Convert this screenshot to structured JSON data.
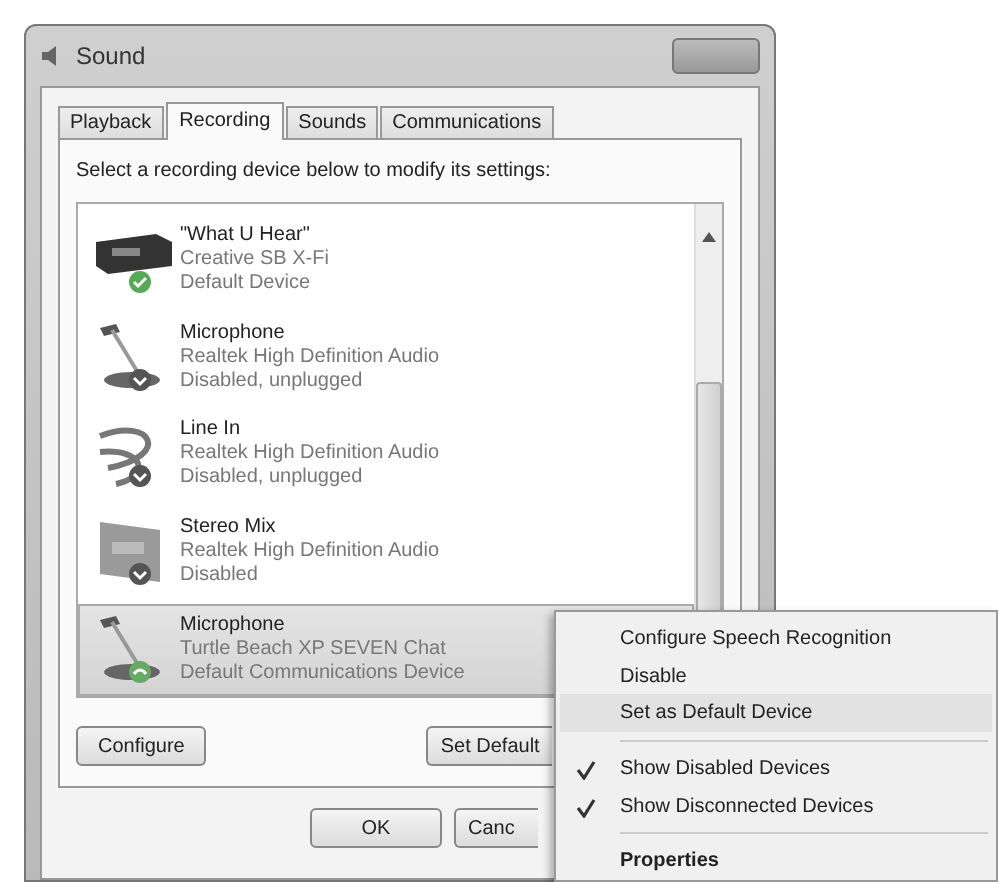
{
  "window": {
    "title": "Sound"
  },
  "tabs": [
    {
      "label": "Playback",
      "selected": false
    },
    {
      "label": "Recording",
      "selected": true
    },
    {
      "label": "Sounds",
      "selected": false
    },
    {
      "label": "Communications",
      "selected": false
    }
  ],
  "instruction": "Select a recording device below to modify its settings:",
  "devices": [
    {
      "kind": "sound-card",
      "name": "\"What U Hear\"",
      "driver": "Creative SB X-Fi",
      "status": "Default Device",
      "default_device": true,
      "default_communications": false,
      "disabled": false,
      "selected": false
    },
    {
      "kind": "microphone",
      "name": "Microphone",
      "driver": "Realtek High Definition Audio",
      "status": "Disabled, unplugged",
      "default_device": false,
      "default_communications": false,
      "disabled": true,
      "selected": false
    },
    {
      "kind": "line-in",
      "name": "Line In",
      "driver": "Realtek High Definition Audio",
      "status": "Disabled, unplugged",
      "default_device": false,
      "default_communications": false,
      "disabled": true,
      "selected": false
    },
    {
      "kind": "stereo-mix",
      "name": "Stereo Mix",
      "driver": "Realtek High Definition Audio",
      "status": "Disabled",
      "default_device": false,
      "default_communications": false,
      "disabled": true,
      "selected": false
    },
    {
      "kind": "microphone",
      "name": "Microphone",
      "driver": "Turtle Beach XP SEVEN Chat",
      "status": "Default Communications Device",
      "default_device": false,
      "default_communications": true,
      "disabled": false,
      "selected": true
    }
  ],
  "buttons": [
    {
      "label": "Configure"
    },
    {
      "label": "Set Default"
    }
  ],
  "footer_buttons": [
    {
      "label": "OK"
    },
    {
      "label": "Canc"
    }
  ],
  "context_menu": {
    "groups": [
      {
        "items": [
          {
            "label": "Configure Speech Recognition",
            "checked": false,
            "bold": false,
            "selected": false
          },
          {
            "label": "Disable",
            "checked": false,
            "bold": false,
            "selected": false
          },
          {
            "label": "Set as Default Device",
            "checked": false,
            "bold": false,
            "selected": true
          }
        ]
      },
      {
        "items": [
          {
            "label": "Show Disabled Devices",
            "checked": true,
            "bold": false,
            "selected": false
          },
          {
            "label": "Show Disconnected Devices",
            "checked": true,
            "bold": false,
            "selected": false
          }
        ]
      },
      {
        "items": [
          {
            "label": "Properties",
            "checked": false,
            "bold": true,
            "selected": false
          }
        ]
      }
    ]
  }
}
